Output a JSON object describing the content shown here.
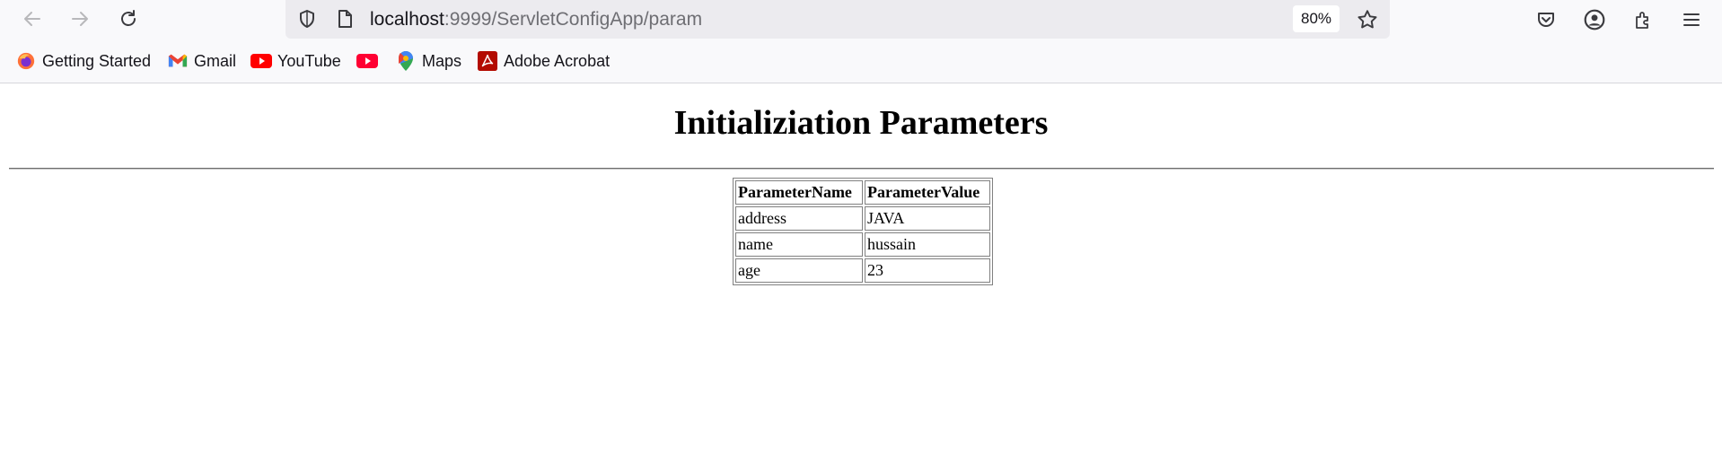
{
  "browser": {
    "url_host": "localhost",
    "url_path": ":9999/ServletConfigApp/param",
    "zoom": "80%",
    "bookmarks": [
      {
        "label": "Getting Started",
        "icon": "firefox-icon"
      },
      {
        "label": "Gmail",
        "icon": "gmail-icon"
      },
      {
        "label": "YouTube",
        "icon": "youtube-icon"
      },
      {
        "label": "",
        "icon": "youtube-music-icon"
      },
      {
        "label": "Maps",
        "icon": "maps-icon"
      },
      {
        "label": "Adobe Acrobat",
        "icon": "acrobat-icon"
      }
    ]
  },
  "page": {
    "title": "Initializiation Parameters",
    "table": {
      "headers": [
        "ParameterName",
        "ParameterValue"
      ],
      "rows": [
        [
          "address",
          "JAVA"
        ],
        [
          "name",
          "hussain"
        ],
        [
          "age",
          "23"
        ]
      ]
    }
  }
}
